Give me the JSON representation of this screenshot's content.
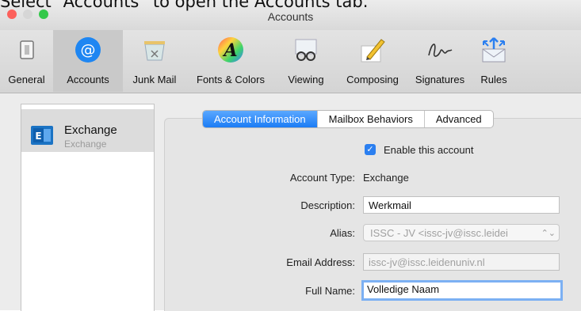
{
  "window": {
    "title": "Accounts"
  },
  "caption": "Select “Accounts” to open the Accounts tab.",
  "toolbar": {
    "items": [
      {
        "label": "General",
        "icon": "switch-icon"
      },
      {
        "label": "Accounts",
        "icon": "at-sign-icon",
        "selected": true
      },
      {
        "label": "Junk Mail",
        "icon": "junk-bin-icon"
      },
      {
        "label": "Fonts & Colors",
        "icon": "font-color-icon"
      },
      {
        "label": "Viewing",
        "icon": "glasses-icon"
      },
      {
        "label": "Composing",
        "icon": "pencil-paper-icon"
      },
      {
        "label": "Signatures",
        "icon": "signature-icon"
      },
      {
        "label": "Rules",
        "icon": "rules-envelope-icon"
      }
    ]
  },
  "sidebar": {
    "accounts": [
      {
        "name": "Exchange",
        "type": "Exchange",
        "icon": "exchange-icon"
      }
    ]
  },
  "tabs": [
    {
      "label": "Account Information",
      "selected": true
    },
    {
      "label": "Mailbox Behaviors"
    },
    {
      "label": "Advanced"
    }
  ],
  "form": {
    "enable_label": "Enable this account",
    "enable_checked": true,
    "account_type_label": "Account Type:",
    "account_type_value": "Exchange",
    "description_label": "Description:",
    "description_value": "Werkmail",
    "alias_label": "Alias:",
    "alias_value": "ISSC - JV <issc-jv@issc.leidei",
    "email_label": "Email Address:",
    "email_placeholder": "issc-jv@issc.leidenuniv.nl",
    "fullname_label": "Full Name:",
    "fullname_value": "Volledige Naam"
  },
  "colors": {
    "accent": "#1c7cf5",
    "close": "#fc605b",
    "minimize": "#d6d6d6",
    "zoom": "#34c84a"
  }
}
